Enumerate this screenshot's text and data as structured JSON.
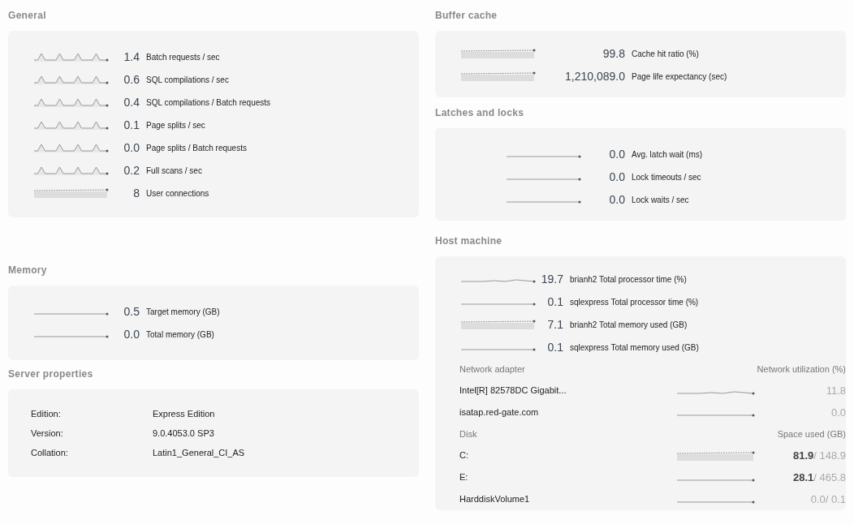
{
  "general": {
    "title": "General",
    "metrics": [
      {
        "value": "1.4",
        "label": "Batch requests / sec",
        "kind": "spiky"
      },
      {
        "value": "0.6",
        "label": "SQL compilations / sec",
        "kind": "spiky"
      },
      {
        "value": "0.4",
        "label": "SQL compilations / Batch requests",
        "kind": "spiky"
      },
      {
        "value": "0.1",
        "label": "Page splits / sec",
        "kind": "spiky"
      },
      {
        "value": "0.0",
        "label": "Page splits / Batch requests",
        "kind": "spiky"
      },
      {
        "value": "0.2",
        "label": "Full scans / sec",
        "kind": "spiky"
      },
      {
        "value": "8",
        "label": "User connections",
        "kind": "band"
      }
    ]
  },
  "memory": {
    "title": "Memory",
    "metrics": [
      {
        "value": "0.5",
        "label": "Target memory (GB)",
        "kind": "flat"
      },
      {
        "value": "0.0",
        "label": "Total memory (GB)",
        "kind": "flat"
      }
    ]
  },
  "server_properties": {
    "title": "Server properties",
    "rows": [
      {
        "name": "Edition:",
        "value": "Express Edition"
      },
      {
        "name": "Version:",
        "value": "9.0.4053.0 SP3"
      },
      {
        "name": "Collation:",
        "value": "Latin1_General_CI_AS"
      }
    ]
  },
  "buffer_cache": {
    "title": "Buffer cache",
    "metrics": [
      {
        "value": "99.8",
        "label": "Cache hit ratio (%)",
        "kind": "band"
      },
      {
        "value": "1,210,089.0",
        "label": "Page life expectancy (sec)",
        "kind": "band"
      }
    ]
  },
  "latches_and_locks": {
    "title": "Latches and locks",
    "metrics": [
      {
        "value": "0.0",
        "label": "Avg. latch wait (ms)",
        "kind": "flat"
      },
      {
        "value": "0.0",
        "label": "Lock timeouts / sec",
        "kind": "flat"
      },
      {
        "value": "0.0",
        "label": "Lock waits / sec",
        "kind": "flat"
      }
    ]
  },
  "host_machine": {
    "title": "Host machine",
    "metrics": [
      {
        "value": "19.7",
        "label": "brianh2 Total processor time (%)",
        "kind": "wavy"
      },
      {
        "value": "0.1",
        "label": "sqlexpress Total processor time (%)",
        "kind": "flat"
      },
      {
        "value": "7.1",
        "label": "brianh2 Total memory used (GB)",
        "kind": "band"
      },
      {
        "value": "0.1",
        "label": "sqlexpress Total memory used (GB)",
        "kind": "flat"
      }
    ],
    "network": {
      "columns": [
        "Network adapter",
        "Network utilization (%)"
      ],
      "rows": [
        {
          "name": "Intel[R] 82578DC Gigabit...",
          "value": "11.8",
          "kind": "wavy"
        },
        {
          "name": "isatap.red-gate.com",
          "value": "0.0",
          "kind": "flat"
        }
      ]
    },
    "disk": {
      "columns": [
        "Disk",
        "Space used (GB)"
      ],
      "rows": [
        {
          "name": "C:",
          "value": "**81.9**/ 148.9",
          "kind": "band"
        },
        {
          "name": "E:",
          "value": "**28.1**/ 465.8",
          "kind": "flat"
        },
        {
          "name": "HarddiskVolume1",
          "value": "0.0/ 0.1",
          "kind": "flat"
        }
      ]
    }
  }
}
